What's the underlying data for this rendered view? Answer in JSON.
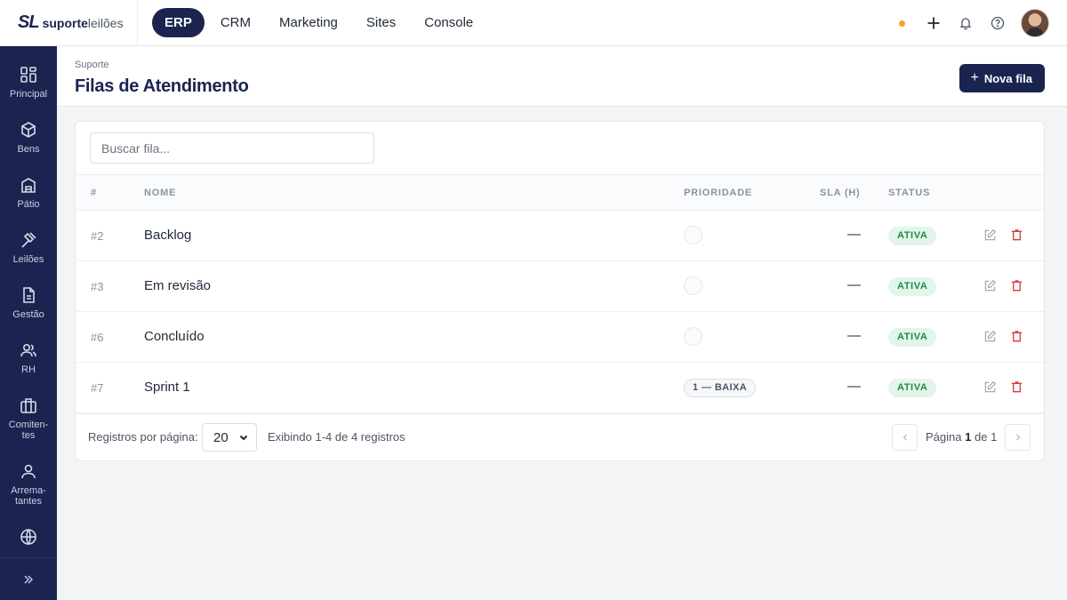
{
  "brand": {
    "mark": "SL",
    "name_bold": "suporte",
    "name_light": "leilões"
  },
  "topnav": {
    "items": [
      "ERP",
      "CRM",
      "Marketing",
      "Sites",
      "Console"
    ],
    "active": "ERP"
  },
  "sidebar": {
    "items": [
      {
        "label": "Principal",
        "icon": "grid-icon"
      },
      {
        "label": "Bens",
        "icon": "cube-icon"
      },
      {
        "label": "Pátio",
        "icon": "warehouse-icon"
      },
      {
        "label": "Leilões",
        "icon": "gavel-icon"
      },
      {
        "label": "Gestão",
        "icon": "document-icon"
      },
      {
        "label": "RH",
        "icon": "users-icon"
      },
      {
        "label": "Comiten-\ntes",
        "icon": "briefcase-icon"
      },
      {
        "label": "Arrema-\ntantes",
        "icon": "user-icon"
      },
      {
        "label": "",
        "icon": "globe-icon"
      }
    ]
  },
  "header": {
    "breadcrumb": "Suporte",
    "title": "Filas de Atendimento",
    "new_button": "Nova fila"
  },
  "search": {
    "placeholder": "Buscar fila..."
  },
  "table": {
    "columns": {
      "id": "#",
      "name": "NOME",
      "priority": "PRIORIDADE",
      "sla": "SLA (H)",
      "status": "STATUS"
    },
    "rows": [
      {
        "id": "#2",
        "name": "Backlog",
        "priority": "",
        "sla": "—",
        "status": "ATIVA"
      },
      {
        "id": "#3",
        "name": "Em revisão",
        "priority": "",
        "sla": "—",
        "status": "ATIVA"
      },
      {
        "id": "#6",
        "name": "Concluído",
        "priority": "",
        "sla": "—",
        "status": "ATIVA"
      },
      {
        "id": "#7",
        "name": "Sprint 1",
        "priority": "1 — BAIXA",
        "sla": "—",
        "status": "ATIVA"
      }
    ]
  },
  "pagination": {
    "per_page_label": "Registros por página:",
    "per_page_value": "20",
    "showing": "Exibindo 1-4 de 4 registros",
    "page_prefix": "Página",
    "page_current": "1",
    "page_sep": "de",
    "page_total": "1"
  },
  "colors": {
    "brand_navy": "#1b2450",
    "status_green": "#1e8a4c",
    "status_green_bg": "#e3f5e9",
    "delete_red": "#d9363e",
    "notification_dot": "#f5a524"
  }
}
